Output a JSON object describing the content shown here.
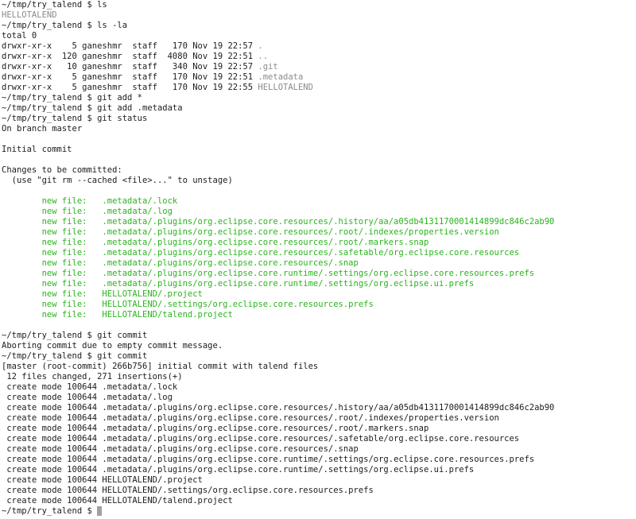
{
  "colors": {
    "background": "#ffffff",
    "text": "#1c1c1c",
    "directory": "#8a8a8a",
    "staged": "#2bb31f",
    "cursor": "#a0a0a0"
  },
  "terminal": {
    "lines": [
      [
        {
          "t": "~/tmp/try_talend $ ls",
          "c": "default"
        }
      ],
      [
        {
          "t": "HELLOTALEND",
          "c": "gray"
        }
      ],
      [
        {
          "t": "~/tmp/try_talend $ ls -la",
          "c": "default"
        }
      ],
      [
        {
          "t": "total 0",
          "c": "default"
        }
      ],
      [
        {
          "t": "drwxr-xr-x    5 ganeshmr  staff   170 Nov 19 22:57 ",
          "c": "default"
        },
        {
          "t": ".",
          "c": "gray"
        }
      ],
      [
        {
          "t": "drwxr-xr-x  120 ganeshmr  staff  4080 Nov 19 22:51 ",
          "c": "default"
        },
        {
          "t": "..",
          "c": "gray"
        }
      ],
      [
        {
          "t": "drwxr-xr-x   10 ganeshmr  staff   340 Nov 19 22:57 ",
          "c": "default"
        },
        {
          "t": ".git",
          "c": "gray"
        }
      ],
      [
        {
          "t": "drwxr-xr-x    5 ganeshmr  staff   170 Nov 19 22:51 ",
          "c": "default"
        },
        {
          "t": ".metadata",
          "c": "gray"
        }
      ],
      [
        {
          "t": "drwxr-xr-x    5 ganeshmr  staff   170 Nov 19 22:55 ",
          "c": "default"
        },
        {
          "t": "HELLOTALEND",
          "c": "gray"
        }
      ],
      [
        {
          "t": "~/tmp/try_talend $ git add *",
          "c": "default"
        }
      ],
      [
        {
          "t": "~/tmp/try_talend $ git add .metadata",
          "c": "default"
        }
      ],
      [
        {
          "t": "~/tmp/try_talend $ git status",
          "c": "default"
        }
      ],
      [
        {
          "t": "On branch master",
          "c": "default"
        }
      ],
      [
        {
          "t": "",
          "c": "default"
        }
      ],
      [
        {
          "t": "Initial commit",
          "c": "default"
        }
      ],
      [
        {
          "t": "",
          "c": "default"
        }
      ],
      [
        {
          "t": "Changes to be committed:",
          "c": "default"
        }
      ],
      [
        {
          "t": "  (use \"git rm --cached <file>...\" to unstage)",
          "c": "default"
        }
      ],
      [
        {
          "t": "",
          "c": "default"
        }
      ],
      [
        {
          "t": "        new file:   .metadata/.lock",
          "c": "green"
        }
      ],
      [
        {
          "t": "        new file:   .metadata/.log",
          "c": "green"
        }
      ],
      [
        {
          "t": "        new file:   .metadata/.plugins/org.eclipse.core.resources/.history/aa/a05db4131170001414899dc846c2ab90",
          "c": "green"
        }
      ],
      [
        {
          "t": "        new file:   .metadata/.plugins/org.eclipse.core.resources/.root/.indexes/properties.version",
          "c": "green"
        }
      ],
      [
        {
          "t": "        new file:   .metadata/.plugins/org.eclipse.core.resources/.root/.markers.snap",
          "c": "green"
        }
      ],
      [
        {
          "t": "        new file:   .metadata/.plugins/org.eclipse.core.resources/.safetable/org.eclipse.core.resources",
          "c": "green"
        }
      ],
      [
        {
          "t": "        new file:   .metadata/.plugins/org.eclipse.core.resources/.snap",
          "c": "green"
        }
      ],
      [
        {
          "t": "        new file:   .metadata/.plugins/org.eclipse.core.runtime/.settings/org.eclipse.core.resources.prefs",
          "c": "green"
        }
      ],
      [
        {
          "t": "        new file:   .metadata/.plugins/org.eclipse.core.runtime/.settings/org.eclipse.ui.prefs",
          "c": "green"
        }
      ],
      [
        {
          "t": "        new file:   HELLOTALEND/.project",
          "c": "green"
        }
      ],
      [
        {
          "t": "        new file:   HELLOTALEND/.settings/org.eclipse.core.resources.prefs",
          "c": "green"
        }
      ],
      [
        {
          "t": "        new file:   HELLOTALEND/talend.project",
          "c": "green"
        }
      ],
      [
        {
          "t": "",
          "c": "default"
        }
      ],
      [
        {
          "t": "~/tmp/try_talend $ git commit",
          "c": "default"
        }
      ],
      [
        {
          "t": "Aborting commit due to empty commit message.",
          "c": "default"
        }
      ],
      [
        {
          "t": "~/tmp/try_talend $ git commit",
          "c": "default"
        }
      ],
      [
        {
          "t": "[master (root-commit) 266b756] initial commit with talend files",
          "c": "default"
        }
      ],
      [
        {
          "t": " 12 files changed, 271 insertions(+)",
          "c": "default"
        }
      ],
      [
        {
          "t": " create mode 100644 .metadata/.lock",
          "c": "default"
        }
      ],
      [
        {
          "t": " create mode 100644 .metadata/.log",
          "c": "default"
        }
      ],
      [
        {
          "t": " create mode 100644 .metadata/.plugins/org.eclipse.core.resources/.history/aa/a05db4131170001414899dc846c2ab90",
          "c": "default"
        }
      ],
      [
        {
          "t": " create mode 100644 .metadata/.plugins/org.eclipse.core.resources/.root/.indexes/properties.version",
          "c": "default"
        }
      ],
      [
        {
          "t": " create mode 100644 .metadata/.plugins/org.eclipse.core.resources/.root/.markers.snap",
          "c": "default"
        }
      ],
      [
        {
          "t": " create mode 100644 .metadata/.plugins/org.eclipse.core.resources/.safetable/org.eclipse.core.resources",
          "c": "default"
        }
      ],
      [
        {
          "t": " create mode 100644 .metadata/.plugins/org.eclipse.core.resources/.snap",
          "c": "default"
        }
      ],
      [
        {
          "t": " create mode 100644 .metadata/.plugins/org.eclipse.core.runtime/.settings/org.eclipse.core.resources.prefs",
          "c": "default"
        }
      ],
      [
        {
          "t": " create mode 100644 .metadata/.plugins/org.eclipse.core.runtime/.settings/org.eclipse.ui.prefs",
          "c": "default"
        }
      ],
      [
        {
          "t": " create mode 100644 HELLOTALEND/.project",
          "c": "default"
        }
      ],
      [
        {
          "t": " create mode 100644 HELLOTALEND/.settings/org.eclipse.core.resources.prefs",
          "c": "default"
        }
      ],
      [
        {
          "t": " create mode 100644 HELLOTALEND/talend.project",
          "c": "default"
        }
      ]
    ],
    "prompt": "~/tmp/try_talend $ "
  }
}
